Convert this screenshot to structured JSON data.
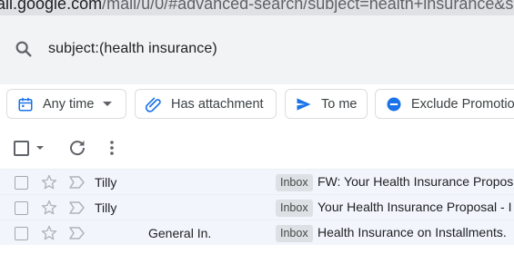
{
  "browser": {
    "url_host": "ail.google.com",
    "url_path": "/mail/u/0/#advanced-search/subject=health+insurance&subset=a"
  },
  "search": {
    "query": "subject:(health insurance)",
    "icon": "search-icon"
  },
  "chips": [
    {
      "label": "Any time",
      "icon": "calendar-icon",
      "dropdown": true
    },
    {
      "label": "Has attachment",
      "icon": "paperclip-icon",
      "dropdown": false
    },
    {
      "label": "To me",
      "icon": "send-icon",
      "dropdown": false
    },
    {
      "label": "Exclude Promotio",
      "icon": "minus-circle-icon",
      "dropdown": false
    }
  ],
  "toolbar": {
    "select_icon": "checkbox-icon",
    "refresh_icon": "refresh-icon",
    "more_icon": "more-vert-icon"
  },
  "messages": [
    {
      "sender": "Tilly",
      "label": "Inbox",
      "subject": "FW: Your Health Insurance Propos"
    },
    {
      "sender": "Tilly",
      "label": "Inbox",
      "subject": "Your Health Insurance Proposal - I"
    },
    {
      "sender": "General In.",
      "label": "Inbox",
      "subject": "Health Insurance on Installments."
    }
  ],
  "colors": {
    "accent_blue": "#1a73e8",
    "header_bg": "#f1f3f4",
    "row_bg": "#f2f6fc"
  }
}
